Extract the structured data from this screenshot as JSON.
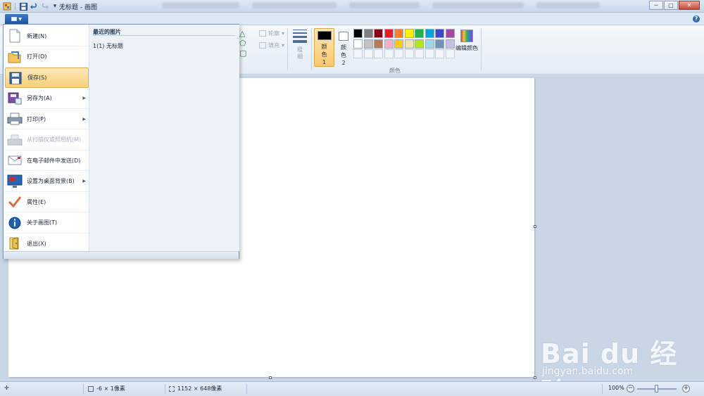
{
  "window": {
    "title": "无标题 - 画图",
    "controls": {
      "minimize": "─",
      "maximize": "□",
      "close": "✕"
    }
  },
  "quick_access": {
    "save_icon": "save-icon",
    "undo_icon": "undo-icon",
    "redo_icon": "redo-icon",
    "dropdown": "▾"
  },
  "app_button": {
    "label": "▼"
  },
  "help": {
    "label": "?"
  },
  "ribbon": {
    "outline_label": "轮廓",
    "fill_label": "填充",
    "size_label": "粗细",
    "color1_label": "颜色 1",
    "color2_label": "颜色 2",
    "colors_group_label": "颜色",
    "edit_colors_label": "编辑颜色",
    "palette_row1": [
      "#000000",
      "#7f7f7f",
      "#880015",
      "#ed1c24",
      "#ff7f27",
      "#fff200",
      "#22b14c",
      "#00a2e8",
      "#3f48cc",
      "#a349a4"
    ],
    "palette_row2": [
      "#ffffff",
      "#c3c3c3",
      "#b97a57",
      "#ffaec9",
      "#ffc90e",
      "#efe4b0",
      "#b5e61d",
      "#99d9ea",
      "#7092be",
      "#c8bfe7"
    ]
  },
  "app_menu": {
    "items": [
      {
        "label": "新建(N)",
        "icon": "new-document-icon",
        "arrow": ""
      },
      {
        "label": "打开(O)",
        "icon": "open-folder-icon",
        "arrow": ""
      },
      {
        "label": "保存(S)",
        "icon": "save-icon",
        "arrow": ""
      },
      {
        "label": "另存为(A)",
        "icon": "save-as-icon",
        "arrow": "▶"
      },
      {
        "label": "打印(P)",
        "icon": "printer-icon",
        "arrow": "▶"
      },
      {
        "label": "从扫描仪或照相机(M)",
        "icon": "scanner-icon",
        "arrow": ""
      },
      {
        "label": "在电子邮件中发送(D)",
        "icon": "email-icon",
        "arrow": ""
      },
      {
        "label": "设置为桌面背景(B)",
        "icon": "desktop-background-icon",
        "arrow": "▶"
      },
      {
        "label": "属性(E)",
        "icon": "checkmark-icon",
        "arrow": ""
      },
      {
        "label": "关于画图(T)",
        "icon": "info-icon",
        "arrow": ""
      },
      {
        "label": "退出(X)",
        "icon": "exit-icon",
        "arrow": ""
      }
    ],
    "highlighted_index": 2,
    "recent_title": "最近的图片",
    "recent_items": [
      "1(1)  无标题"
    ]
  },
  "statusbar": {
    "cursor_pos": "-6 × 1像素",
    "image_size": "1152 × 648像素",
    "zoom": "100%",
    "zoom_out": "−",
    "zoom_in": "+"
  },
  "watermark": {
    "brand": "Bai du 经验",
    "url": "jingyan.baidu.com"
  },
  "colors": {
    "accent": "#1e55a3",
    "highlight": "#f9cf79",
    "arrow": "#e53935"
  }
}
